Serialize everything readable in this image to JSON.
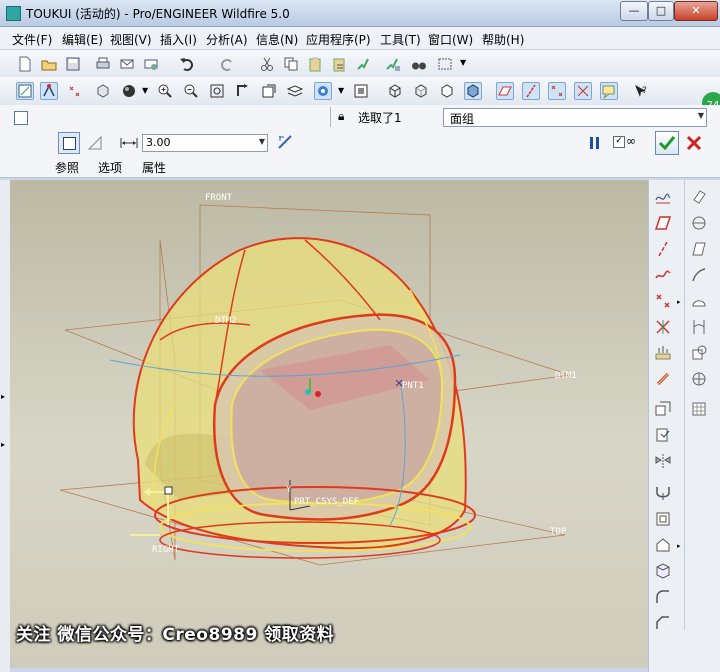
{
  "window": {
    "title": "TOUKUI (活动的) - Pro/ENGINEER Wildfire 5.0",
    "minimize": "—",
    "maximize": "□",
    "close": "✕"
  },
  "menu": [
    "文件(F)",
    "编辑(E)",
    "视图(V)",
    "插入(I)",
    "分析(A)",
    "信息(N)",
    "应用程序(P)",
    "工具(T)",
    "窗口(W)",
    "帮助(H)"
  ],
  "dashboard": {
    "selected_label": "选取了1",
    "filter_value": "面组",
    "thickness_value": "3.00",
    "tabs": [
      "参照",
      "选项",
      "属性"
    ]
  },
  "badge": "74",
  "model_labels": {
    "front": "FRONT",
    "right": "RIGHT",
    "top": "TOP",
    "dtm1": "DTM1",
    "pnt1": "PNT1",
    "csys": "PRT_CSYS_DEF",
    "dtm2": "DTM2",
    "y_axis": "Y"
  },
  "watermark": "关注 微信公众号：Creo8989 领取资料",
  "colors": {
    "accent": "#2fa6a6",
    "ok_green": "#1f9b2e",
    "cancel_red": "#d02020",
    "surface_edge": "#e03a1a",
    "surface_yellow": "#f2e25a"
  }
}
